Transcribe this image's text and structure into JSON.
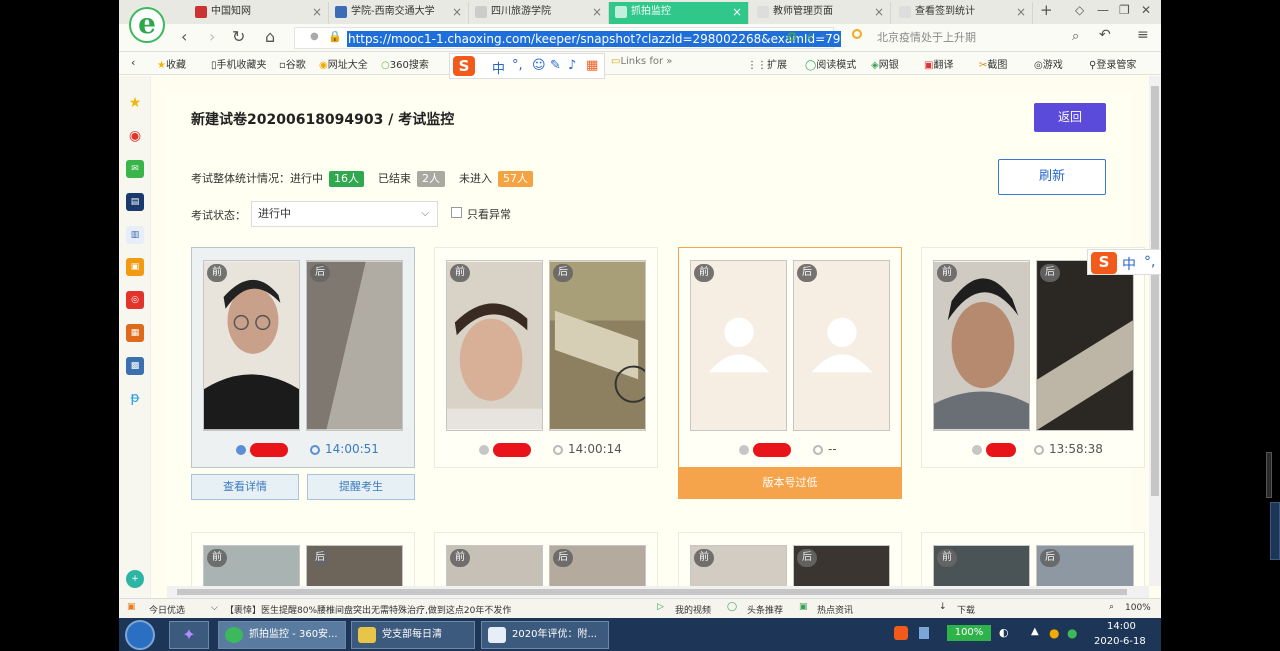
{
  "browser": {
    "tabs": [
      {
        "label": "中国知网",
        "active": false
      },
      {
        "label": "学院-西南交通大学",
        "active": false
      },
      {
        "label": "四川旅游学院",
        "active": false
      },
      {
        "label": "抓拍监控",
        "active": true
      },
      {
        "label": "教师管理页面",
        "active": false
      },
      {
        "label": "查看签到统计",
        "active": false
      }
    ],
    "url": "https://mooc1-1.chaoxing.com/keeper/snapshot?clazzId=298002268&examId=79",
    "search_hint": "北京疫情处于上升期",
    "bookmarks": [
      "收藏",
      "手机收藏夹",
      "谷歌",
      "网址大全",
      "360搜索",
      "Links for"
    ],
    "bookmarks_right": [
      "扩展",
      "阅读模式",
      "网银",
      "翻译",
      "截图",
      "游戏",
      "登录管家"
    ],
    "ime_cn": "中"
  },
  "page": {
    "title": "新建试卷20200618094903 / 考试监控",
    "back_label": "返回",
    "refresh_label": "刷新",
    "stats_label": "考试整体统计情况：",
    "in_progress_label": "进行中",
    "in_progress_count": "16人",
    "finished_label": "已结束",
    "finished_count": "2人",
    "not_entered_label": "未进入",
    "not_entered_count": "57人",
    "status_label": "考试状态：",
    "status_value": "进行中",
    "only_abnormal_label": "只看异常",
    "front_label": "前",
    "back_photo_label": "后",
    "cards": [
      {
        "time": "14:00:51",
        "details_label": "查看详情",
        "remind_label": "提醒考生"
      },
      {
        "time": "14:00:14"
      },
      {
        "time": "--",
        "warning": "版本号过低"
      },
      {
        "time": "13:58:38"
      }
    ]
  },
  "statusbar": {
    "left": "今日优选",
    "news": "【裹悻】医生提醒80%腰椎间盘突出无需特殊治疗,做到这点20年不发作",
    "items": [
      "我的视频",
      "头条推荐",
      "热点资讯",
      "下载"
    ],
    "zoom": "100%"
  },
  "taskbar": {
    "tasks": [
      "抓拍监控 - 360安...",
      "党支部每日清",
      "2020年评优：附..."
    ],
    "battery": "100%",
    "time": "14:00",
    "date": "2020-6-18"
  },
  "colors": {
    "accent": "#5b4bdb",
    "green_badge": "#2fa84f",
    "grey_badge": "#a9a9a1",
    "orange_badge": "#f5a342",
    "tab_active": "#2fc88a"
  }
}
